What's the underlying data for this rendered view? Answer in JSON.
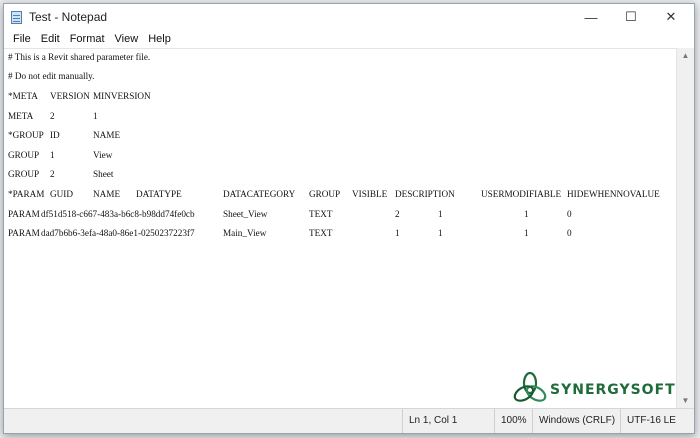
{
  "window": {
    "title": "Test - Notepad",
    "buttons": {
      "minimize": "—",
      "maximize": "☐",
      "close": "✕"
    }
  },
  "menu": [
    "File",
    "Edit",
    "Format",
    "View",
    "Help"
  ],
  "document": {
    "comment1": "# This is a Revit shared parameter file.",
    "comment2": "# Do not edit manually.",
    "meta_header": [
      "*META",
      "VERSION",
      "MINVERSION"
    ],
    "meta_row": [
      "META",
      "2",
      "1"
    ],
    "group_header": [
      "*GROUP",
      "ID",
      "NAME"
    ],
    "group_rows": [
      [
        "GROUP",
        "1",
        "View"
      ],
      [
        "GROUP",
        "2",
        "Sheet"
      ]
    ],
    "param_header": [
      "*PARAM",
      "GUID",
      "NAME",
      "DATATYPE",
      "DATACATEGORY",
      "GROUP",
      "VISIBLE",
      "DESCRIPTION",
      "USERMODIFIABLE",
      "HIDEWHENNOVALUE"
    ],
    "param_rows": [
      [
        "PARAM",
        "df51d518-c667-483a-b6c8-b98dd74fe0cb",
        "Sheet_View",
        "TEXT",
        "2",
        "1",
        "1",
        "0"
      ],
      [
        "PARAM",
        "dad7b6b6-3efa-48a0-86e1-0250237223f7",
        "Main_View",
        "TEXT",
        "1",
        "1",
        "1",
        "0"
      ]
    ]
  },
  "status": {
    "position": "Ln 1, Col 1",
    "zoom": "100%",
    "line_ending": "Windows (CRLF)",
    "encoding": "UTF-16 LE"
  },
  "watermark": {
    "text": "SYNERGYSOFT",
    "color": "#1f6b3a"
  }
}
